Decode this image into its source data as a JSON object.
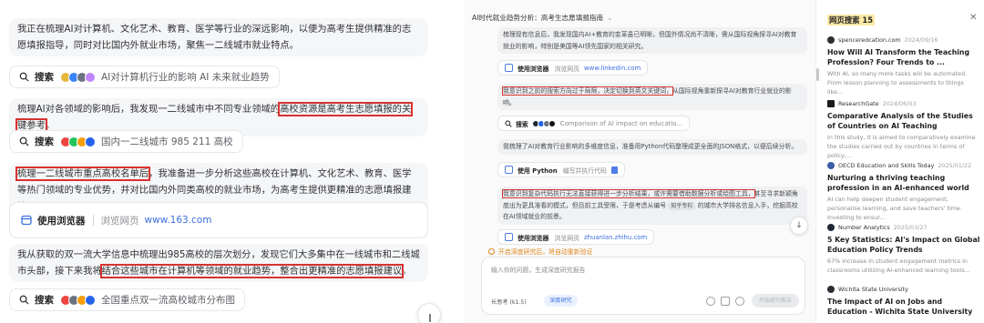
{
  "left": {
    "cards": [
      "我正在梳理AI对计算机、文化艺术、教育、医学等行业的深远影响，以便为高考生提供精准的志愿填报指导，同时对比国内外就业市场，聚焦一二线城市就业特点。",
      "梳理AI对各领域的影响后，我发现一二线城市中不同专业领域的高校资源是高考生志愿填报的关键参考。",
      "梳理一二线城市重点高校名单后，我准备进一步分析这些高校在计算机、文化艺术、教育、医学等热门领域的专业优势，并对比国内外同类高校的就业市场，为高考生提供更精准的志愿填报建议。",
      "我从获取的双一流大学信息中梳理出985高校的层次划分，发现它们大多集中在一线城市和二线城市头部，接下来我将结合这些城市在计算机等领域的就业趋势，整合出更精准的志愿填报建议。"
    ],
    "card_parts": {
      "c2_pre": "梳理AI对各领域的影响后，我发现一二线城市中不同专业领域的",
      "c2_hl": "高校资源是高考生志愿填报的关键参考",
      "c2_post": "。",
      "c3_hl": "梳理一二线城市重点高校名单后",
      "c3_post": "，我准备进一步分析这些高校在计算机、文化艺术、教育、医学等热门领域的专业优势，并对比国内外同类高校的就业市场，为高考生提供更精准的志愿填报建议。",
      "c4_pre": "我从获取的双一流大学信息中梳理出985高校的层次划分，发现它们大多集中在一线城市和二线城市头部，接下来我将",
      "c4_hl": "结合这些城市在计算机等领域的就业趋势，整合出更精准的志愿填报建议",
      "c4_post": "。"
    },
    "search_label": "搜索",
    "searches": [
      "AI对计算机行业的影响 AI 未来就业趋势",
      "国内一二线城市 985 211 高校",
      "全国重点双一流高校城市分布图"
    ],
    "browser": {
      "title": "使用浏览器",
      "sub": "浏览网页",
      "url": "www.163.com"
    }
  },
  "mid": {
    "title": "AI时代就业趋势分析：高考生志愿填报指南",
    "card1": "梳理现有信息后，我发现国内AI+教育的变革虽已明晰，但国外情况尚不清晰，需从国际视角探寻AI对教育就业的影响，特别是美国等AI领先国家的相关研究。",
    "browser1": {
      "label": "使用浏览器",
      "sub": "浏览网页",
      "url": "www.linkedin.com"
    },
    "card2_hl": "我意识到之前的搜索方向过于局限，决定切换到英文关键词，",
    "card2_post": "从国际视角重新探寻AI对教育行业就业的影响。",
    "search": {
      "label": "搜索",
      "query": "Comparison of AI impact on educatio..."
    },
    "card3": "我梳理了AI对教育行业影响的多维度信息，准备用Python代码整理成更全面的JSON格式，以便后续分析。",
    "python": {
      "label": "使用 Python",
      "sub": "编写并执行代码"
    },
    "card4_hl": "我意识到复杂代码执行无法直接获得进一步分析结果，或许需要借助数据分析或绘图工具，",
    "card4_post1": "甚至寻求新颖角度出为更具准看的模式，但目前工具受限，于是考虑从编号",
    "card4_tag": "知乎专栏",
    "card4_post2": "的城市大学排名信息入手，挖掘高校在AI领域就业的前景。",
    "browser2": {
      "label": "使用浏览器",
      "sub": "浏览网页",
      "url": "zhuanlan.zhihu.com"
    },
    "notice": "开启深度研究后，将自动重新验证",
    "input_placeholder": "输入你的问题，生成深度研究报告",
    "model": "长思考 (k1.5)",
    "deep_mode": "深度研究",
    "send": "开始研究报告"
  },
  "right": {
    "title": "网页搜索 15",
    "results": [
      {
        "source": "spenceredcation.com",
        "date": "2024/09/16",
        "title": "How Will AI Transform the Teaching Profession? Four Trends to ...",
        "snippet": "With AI, so many more tasks will be automated. From lesson planning to assessments to things like...",
        "color": "#2b2d33"
      },
      {
        "source": "ResearchGate",
        "date": "2024/06/03",
        "title": "Comparative Analysis of the Studies of Countries on AI Teaching",
        "snippet": "In this study, it is aimed to comparatively examine the studies carried out by countries in terms of policy,...",
        "color": "#1a1a1a"
      },
      {
        "source": "OECD Education and Skills Today",
        "date": "2025/01/22",
        "title": "Nurturing a thriving teaching profession in an AI-enhanced world",
        "snippet": "AI can help deepen student engagement, personalise learning, and save teachers' time. Investing to ensur...",
        "color": "#3a5ca8"
      },
      {
        "source": "Number Analytics",
        "date": "2025/03/27",
        "title": "5 Key Statistics: AI's Impact on Global Education Policy Trends",
        "snippet": "67% increase in student engagement metrics in classrooms utilizing AI-enhanced learning tools...",
        "color": "#1f2937"
      },
      {
        "source": "Wichita State University",
        "date": "",
        "title": "The Impact of AI on Jobs and Education - Wichita State University",
        "snippet": "",
        "color": "#2b2d33"
      }
    ]
  },
  "colors": {
    "highlight": "#d9322f",
    "link": "#3b6fe0",
    "badge": "#fbe9a6",
    "warning": "#e0861a"
  }
}
